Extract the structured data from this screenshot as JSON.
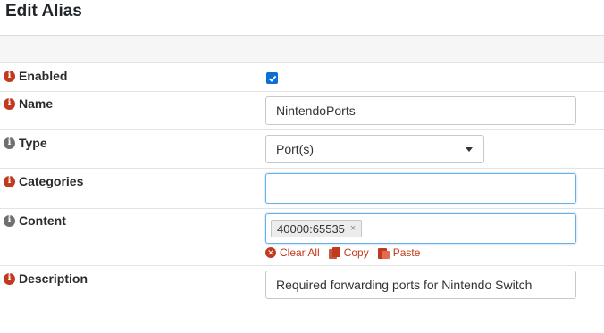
{
  "header": {
    "title": "Edit Alias"
  },
  "rows": {
    "enabled": {
      "label": "Enabled",
      "checked": true
    },
    "name": {
      "label": "Name",
      "value": "NintendoPorts"
    },
    "type": {
      "label": "Type",
      "selected": "Port(s)"
    },
    "categories": {
      "label": "Categories",
      "value": ""
    },
    "content": {
      "label": "Content",
      "tags": [
        "40000:65535"
      ],
      "tag_remove_glyph": "×",
      "actions": {
        "clear": "Clear All",
        "copy": "Copy",
        "paste": "Paste"
      }
    },
    "description": {
      "label": "Description",
      "value": "Required forwarding ports for Nintendo Switch"
    }
  },
  "icons": {
    "info": "info-icon",
    "clear": "x-circle-icon",
    "copy": "copy-icon",
    "paste": "paste-icon",
    "checkbox": "checkmark-icon",
    "caret": "caret-down-icon"
  },
  "colors": {
    "accent": "#c13a1e",
    "info_gray": "#6f6f6f",
    "focus": "#66afe9",
    "checkbox": "#0b6fd6"
  }
}
